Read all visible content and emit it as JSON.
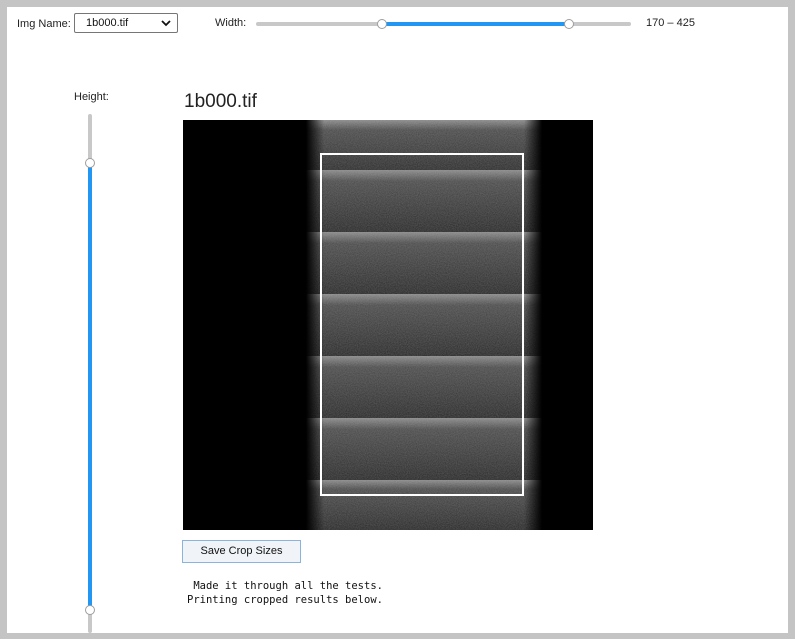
{
  "controls": {
    "img_name_label": "Img Name:",
    "img_name_value": "1b000.tif",
    "width_label": "Width:",
    "width_range_text": "170 – 425",
    "width_range": {
      "min_value": 170,
      "max_value": 425,
      "low_fraction": 0.335,
      "high_fraction": 0.835
    },
    "height_label": "Height:",
    "height_range": {
      "low_fraction": 0.095,
      "high_fraction": 0.955
    }
  },
  "main": {
    "image_title": "1b000.tif",
    "save_button_label": "Save Crop Sizes",
    "log_lines": [
      " Made it through all the tests.",
      "Printing cropped results below."
    ]
  },
  "colors": {
    "accent": "#2196f3",
    "crop_box": "#ffffff",
    "image_background": "#000000"
  },
  "icons": {
    "dropdown": "chevron-down-icon"
  }
}
